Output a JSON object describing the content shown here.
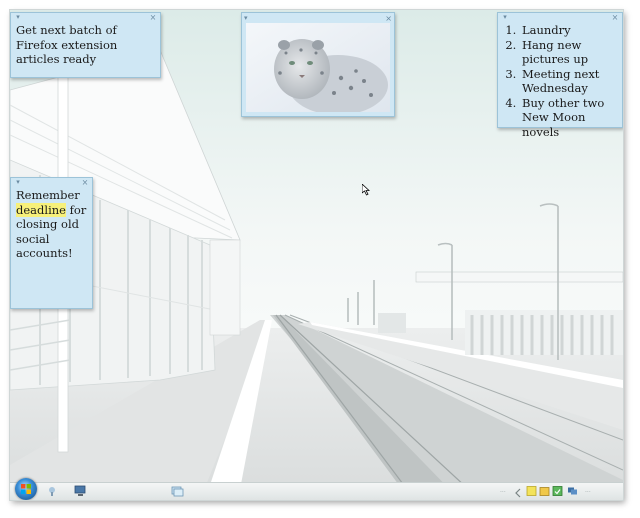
{
  "notes": {
    "firefox": {
      "text": "Get next batch of Firefox extension articles ready"
    },
    "todo": {
      "items": [
        "Laundry",
        "Hang new pictures up",
        "Meeting next Wednesday",
        "Buy other two New Moon novels"
      ]
    },
    "reminder": {
      "before": "Remember ",
      "highlight": "deadline",
      "after": " for closing old social accounts!"
    }
  },
  "photo": {
    "subject": "snow leopard"
  },
  "taskbar": {
    "quick_launch": [
      "show-desktop",
      "computer"
    ],
    "tray_text": "..."
  },
  "icons": {
    "note_close": "×",
    "note_grip": "▾"
  },
  "colors": {
    "note_bg": "#cfe7f4",
    "highlight": "#f7f07a",
    "wallpaper_sky": "#e9f3f1"
  }
}
